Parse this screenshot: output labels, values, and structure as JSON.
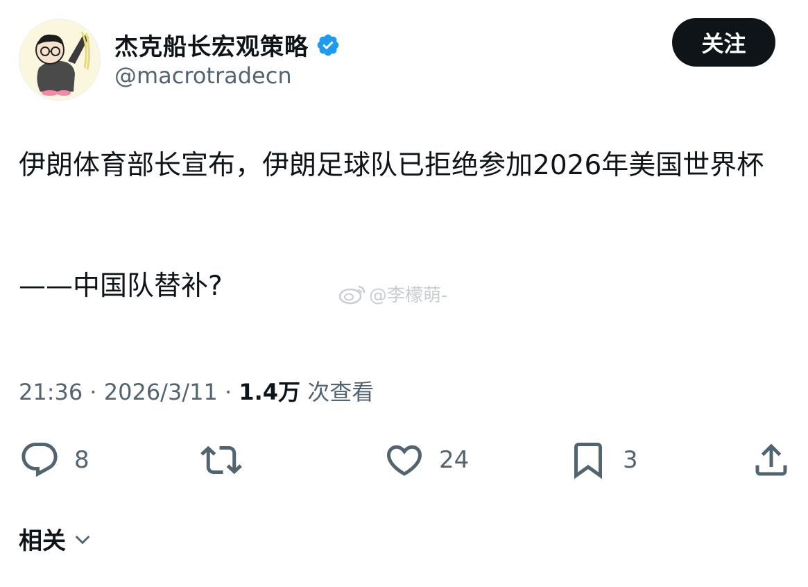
{
  "author": {
    "display_name": "杰克船长宏观策略",
    "handle": "@macrotradecn",
    "avatar_icon": "cartoon-avatar-icon",
    "verified_icon": "verified-badge-icon"
  },
  "follow_button_label": "关注",
  "tweet": {
    "line1": "伊朗体育部长宣布，伊朗足球队已拒绝参加2026年美国世界杯",
    "line2": "——中国队替补?"
  },
  "watermark": "@李檬萌-",
  "meta": {
    "time": "21:36",
    "separator": "·",
    "date": "2026/3/11",
    "views_count": "1.4万",
    "views_label": "次查看"
  },
  "actions": {
    "reply_count": "8",
    "like_count": "24",
    "bookmark_count": "3"
  },
  "related_label": "相关",
  "colors": {
    "text_primary": "#0f1419",
    "text_secondary": "#536471",
    "verified_blue": "#1d9bf0",
    "button_bg": "#0f1419"
  }
}
